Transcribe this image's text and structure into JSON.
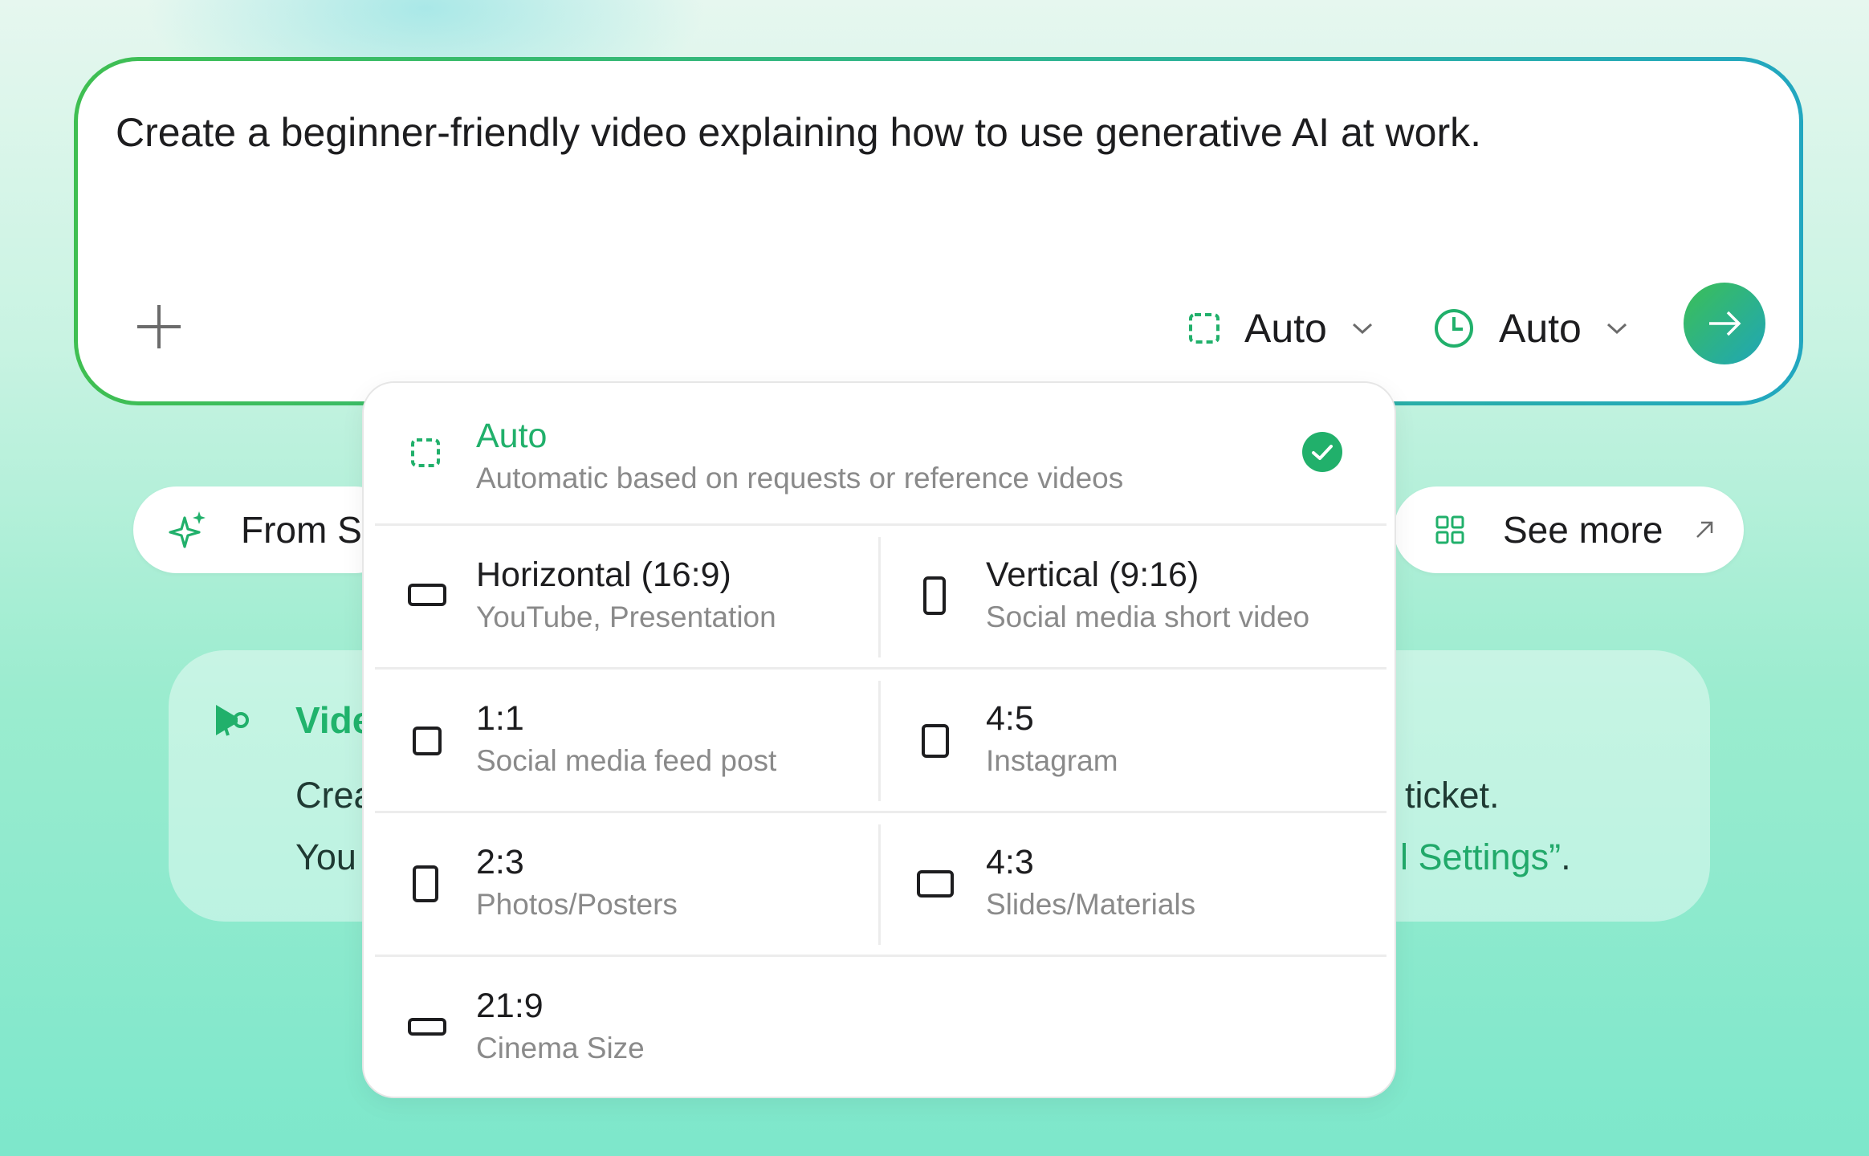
{
  "prompt": {
    "text": "Create a beginner-friendly video explaining how to use generative AI at work."
  },
  "controls": {
    "add_icon": "plus-icon",
    "ratio": {
      "icon": "dashed-square-icon",
      "value": "Auto"
    },
    "duration": {
      "icon": "clock-icon",
      "value": "Auto"
    },
    "send_icon": "arrow-right-icon"
  },
  "chips": {
    "from_sample": {
      "label": "From Sa",
      "icon": "sparkle-icon"
    },
    "see_more": {
      "label": "See more",
      "icon": "grid-icon"
    }
  },
  "notice": {
    "title": "Vide",
    "line1_left": "Crea",
    "line1_right": "ticket.",
    "line2_left": "You",
    "line2_right_link": "l Settings”",
    "line2_right_end": "."
  },
  "aspect_dropdown": {
    "selected": "Auto",
    "auto": {
      "label": "Auto",
      "desc": "Automatic based on requests or reference videos"
    },
    "options": [
      {
        "label": "Horizontal (16:9)",
        "desc": "YouTube, Presentation"
      },
      {
        "label": "Vertical (9:16)",
        "desc": "Social media short video"
      },
      {
        "label": "1:1",
        "desc": "Social media feed post"
      },
      {
        "label": "4:5",
        "desc": "Instagram"
      },
      {
        "label": "2:3",
        "desc": "Photos/Posters"
      },
      {
        "label": "4:3",
        "desc": "Slides/Materials"
      },
      {
        "label": "21:9",
        "desc": "Cinema Size"
      }
    ]
  },
  "colors": {
    "accent": "#21b06b",
    "gradient_start": "#3fbf52",
    "gradient_end": "#22a7c0"
  }
}
